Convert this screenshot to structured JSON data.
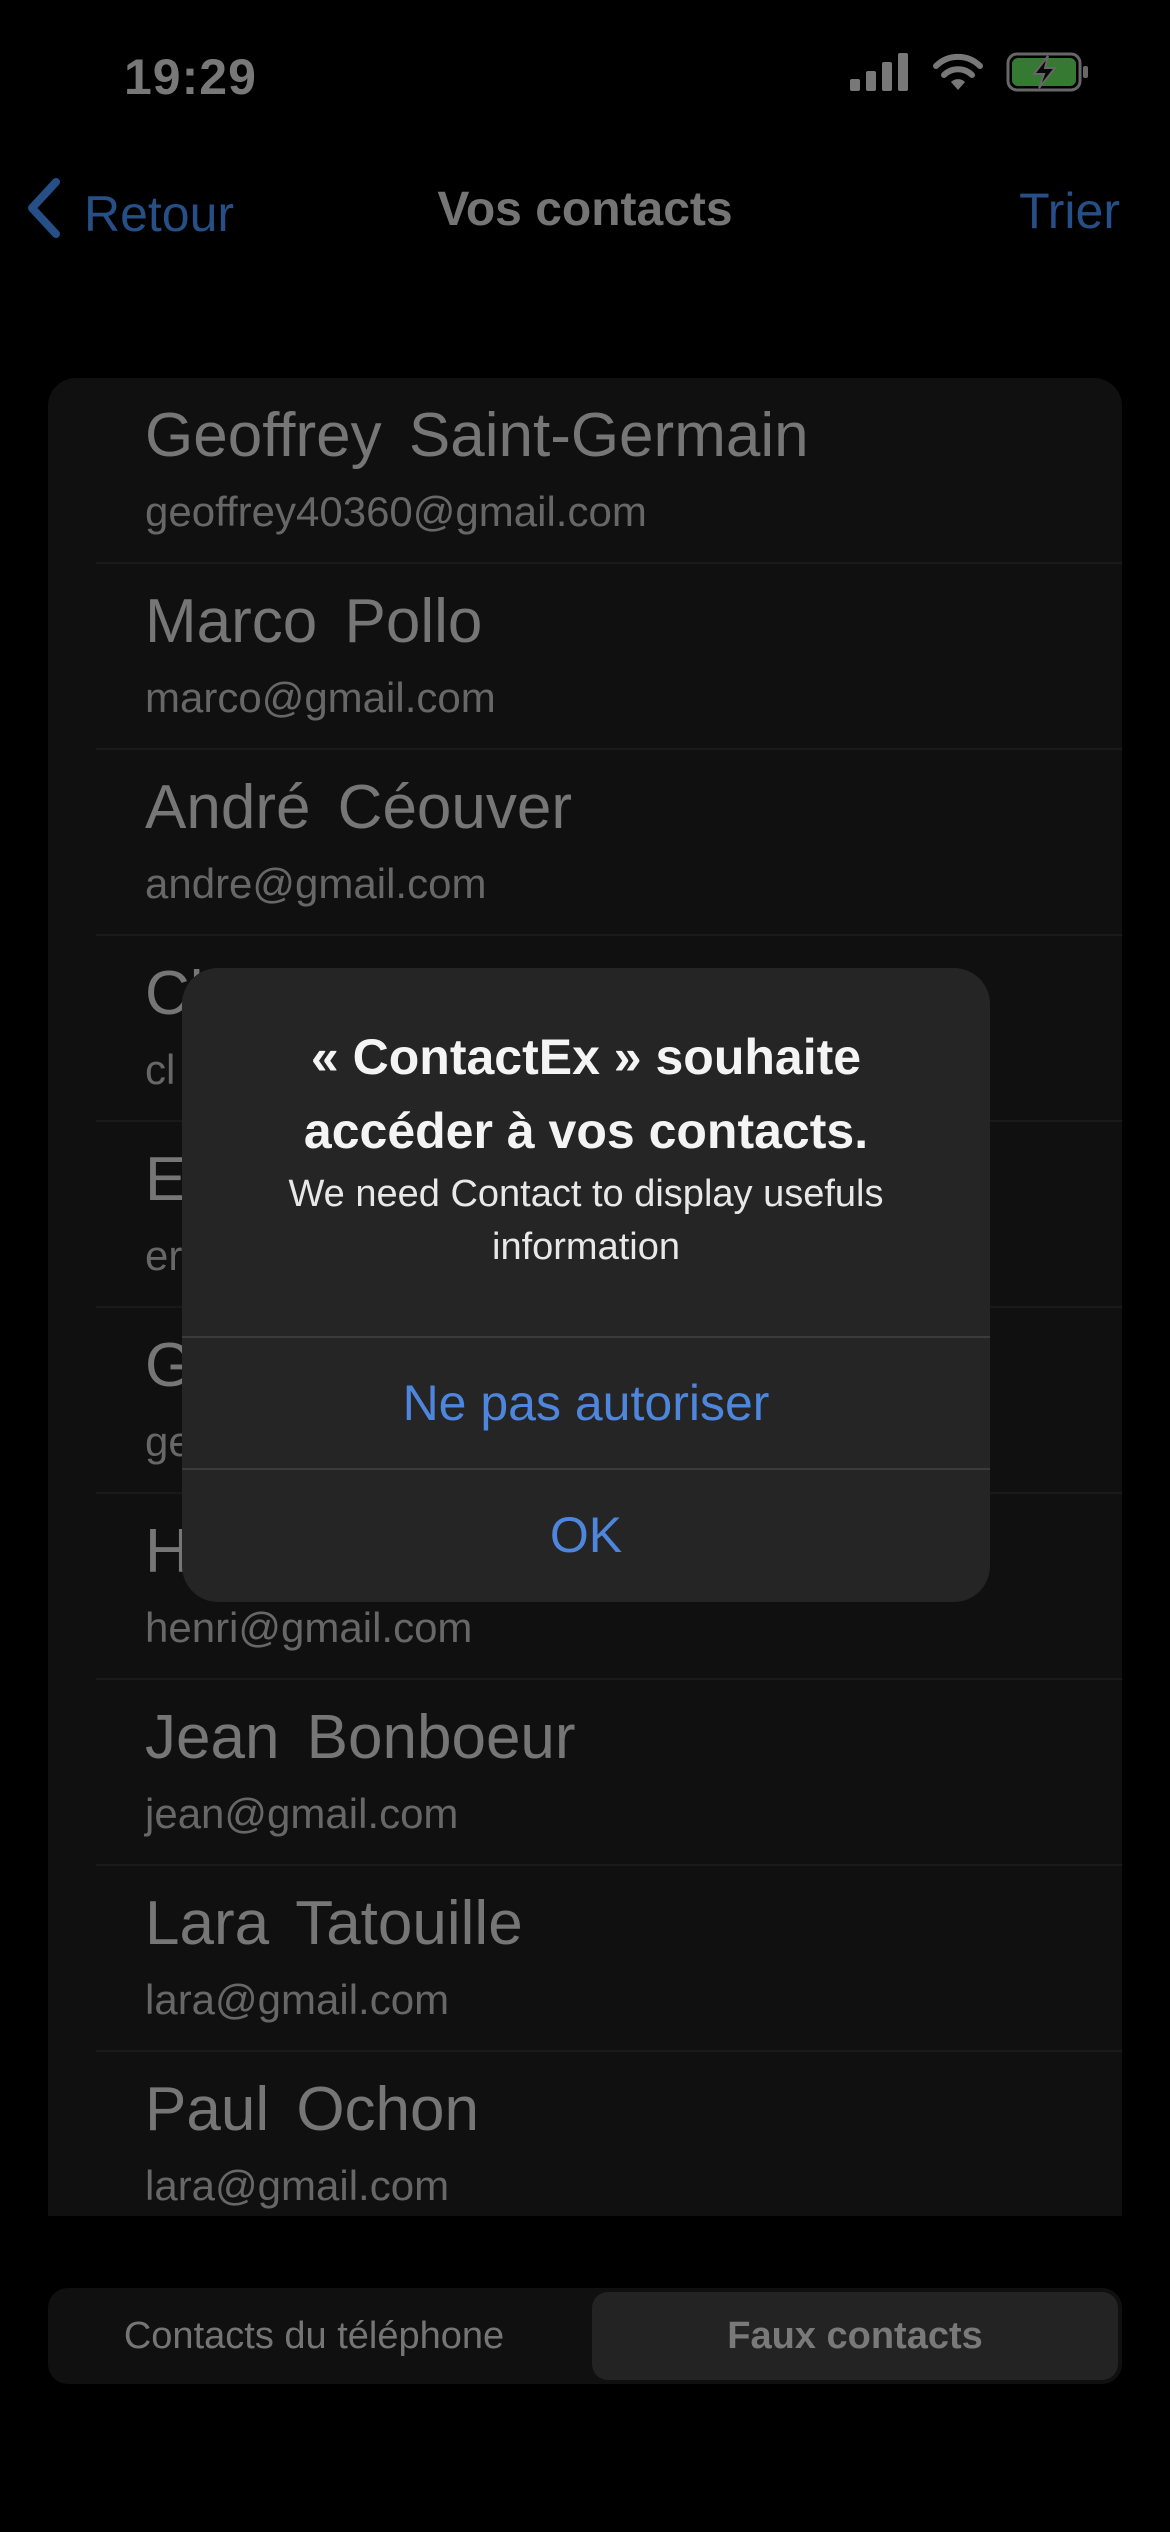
{
  "status_bar": {
    "time": "19:29",
    "icons": [
      "cellular-signal-icon",
      "wifi-icon",
      "battery-charging-icon"
    ],
    "battery_color": "#4cd964"
  },
  "nav": {
    "back_label": "Retour",
    "title": "Vos contacts",
    "sort_label": "Trier",
    "accent_color": "#2d5d9f"
  },
  "contacts": [
    {
      "name": "Geoffrey Saint-Germain",
      "email": "geoffrey40360@gmail.com"
    },
    {
      "name": "Marco Pollo",
      "email": "marco@gmail.com"
    },
    {
      "name": "André Céouver",
      "email": "andre@gmail.com"
    },
    {
      "name": "Cl",
      "email": "cl"
    },
    {
      "name": "E",
      "email": "er"
    },
    {
      "name": "G",
      "email": "ge"
    },
    {
      "name": "H",
      "email": "henri@gmail.com"
    },
    {
      "name": "Jean Bonboeur",
      "email": "jean@gmail.com"
    },
    {
      "name": "Lara Tatouille",
      "email": "lara@gmail.com"
    },
    {
      "name": "Paul Ochon",
      "email": "lara@gmail.com"
    }
  ],
  "segmented_control": {
    "left_label": "Contacts du téléphone",
    "right_label": "Faux contacts",
    "selected": "Faux contacts"
  },
  "alert": {
    "title": "« ContactEx » souhaite accéder à vos contacts.",
    "message": "We need Contact to display usefuls information",
    "deny_label": "Ne pas autoriser",
    "ok_label": "OK",
    "button_color": "#4d86dc"
  }
}
